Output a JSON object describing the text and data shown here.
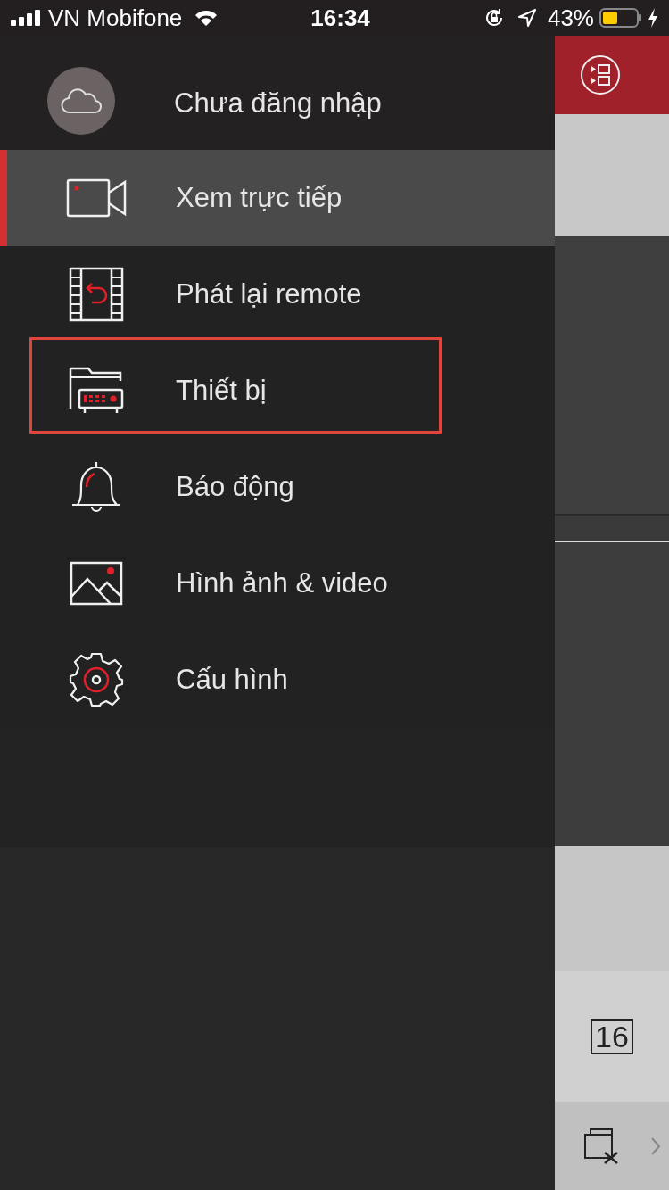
{
  "status_bar": {
    "carrier": "VN Mobifone",
    "time": "16:34",
    "battery": "43%"
  },
  "drawer": {
    "account": {
      "label": "Chưa đăng nhập"
    },
    "items": [
      {
        "label": "Xem trực tiếp",
        "selected": true,
        "highlighted": false
      },
      {
        "label": "Phát lại remote",
        "selected": false,
        "highlighted": false
      },
      {
        "label": "Thiết bị",
        "selected": false,
        "highlighted": true
      },
      {
        "label": "Báo động",
        "selected": false,
        "highlighted": false
      },
      {
        "label": "Hình ảnh & video",
        "selected": false,
        "highlighted": false
      },
      {
        "label": "Cấu hình",
        "selected": false,
        "highlighted": false
      }
    ]
  },
  "toolbar": {
    "layout_button": "16"
  }
}
